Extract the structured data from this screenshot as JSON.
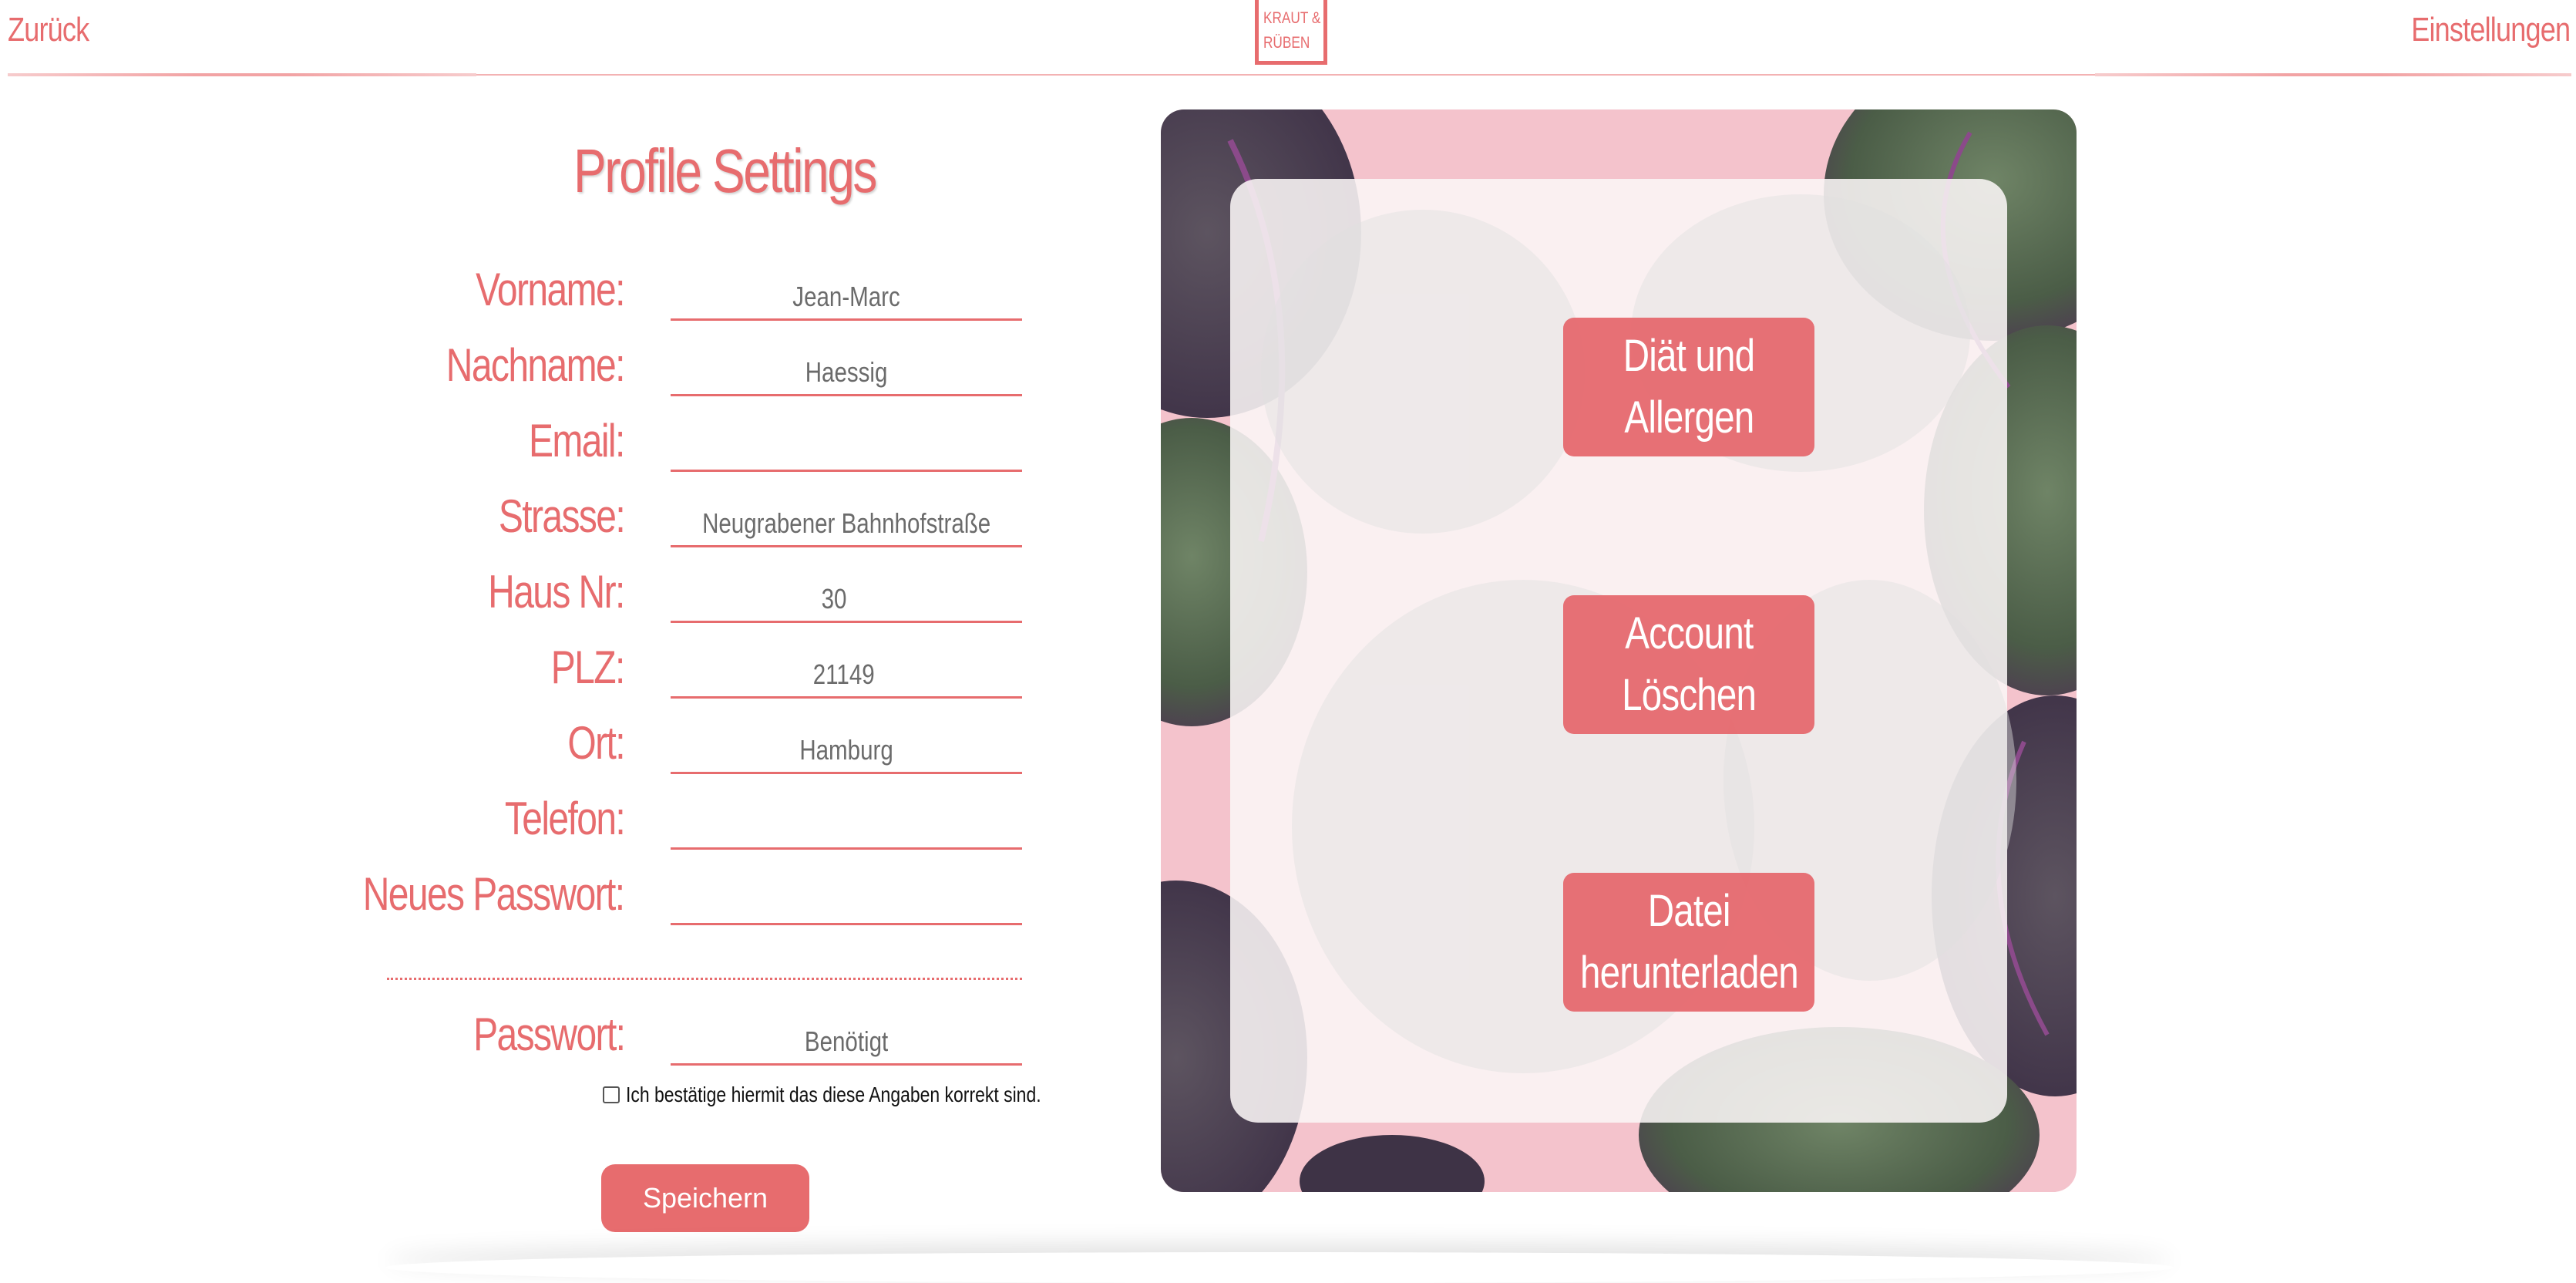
{
  "header": {
    "back_label": "Zurück",
    "settings_label": "Einstellungen",
    "logo_line1": "KRAUT &",
    "logo_line2": "RÜBEN"
  },
  "form": {
    "title": "Profile Settings",
    "fields": [
      {
        "label": "Vorname:",
        "value": "Jean-Marc"
      },
      {
        "label": "Nachname:",
        "value": "Haessig"
      },
      {
        "label": "Email:",
        "value": ""
      },
      {
        "label": "Strasse:",
        "value": "Neugrabener Bahnhofstraße"
      },
      {
        "label": "Haus Nr:",
        "value": "30"
      },
      {
        "label": "PLZ:",
        "value": "21149"
      },
      {
        "label": "Ort:",
        "value": "Hamburg"
      },
      {
        "label": "Telefon:",
        "value": ""
      },
      {
        "label": "Neues Passwort:",
        "value": ""
      }
    ],
    "password": {
      "label": "Passwort:",
      "placeholder": "Benötigt"
    },
    "confirm_text": "Ich bestätige hiermit das diese Angaben korrekt sind.",
    "save_label": "Speichern"
  },
  "actions": {
    "diet_line1": "Diät und",
    "diet_line2": "Allergen",
    "delete_line1": "Account",
    "delete_line2": "Löschen",
    "download_line1": "Datei",
    "download_line2": "herunterladen"
  },
  "colors": {
    "accent": "#e76c6e",
    "panel_bg": "#f4c3cc",
    "leaf_dark": "#4a5a47"
  }
}
